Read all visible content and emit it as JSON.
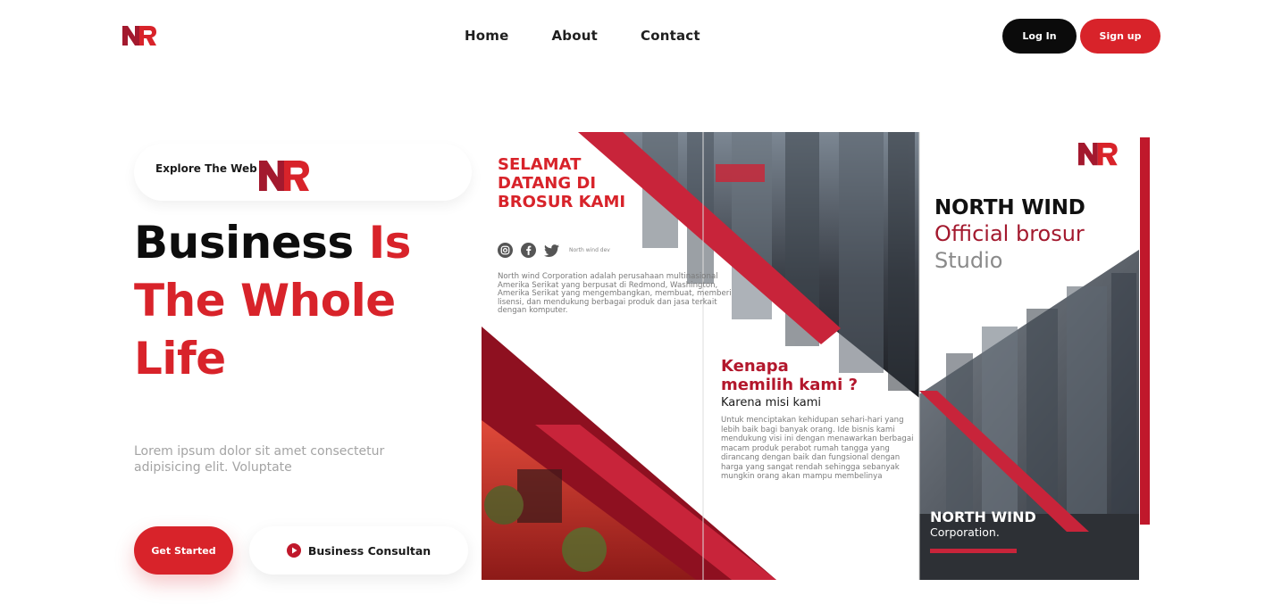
{
  "header": {
    "nav": [
      "Home",
      "About",
      "Contact"
    ],
    "login_label": "Log In",
    "signup_label": "Sign up"
  },
  "hero": {
    "explore_label": "Explore The Web",
    "headline_black": "Business",
    "headline_red_1": "Is",
    "headline_red_2": "The Whole",
    "headline_red_3": "Life",
    "description": "Lorem ipsum dolor sit amet consectetur adipisicing elit. Voluptate",
    "get_started_label": "Get Started",
    "consult_label": "Business Consultan"
  },
  "brochure": {
    "welcome_line1": "SELAMAT",
    "welcome_line2": "DATANG DI",
    "welcome_line3": "BROSUR KAMI",
    "social_handle": "North wind dev",
    "panel1_body": "North wind Corporation adalah perusahaan multinasional Amerika Serikat yang berpusat di Redmond, Washington, Amerika Serikat yang mengembangkan, membuat, memberi lisensi, dan mendukung berbagai produk dan jasa terkait dengan komputer.",
    "why_line1": "Kenapa",
    "why_line2": "memilih kami ?",
    "mission": "Karena misi kami",
    "panel2_body": "Untuk menciptakan kehidupan sehari-hari yang lebih baik bagi banyak orang. Ide bisnis kami mendukung visi ini dengan menawarkan berbagai macam produk perabot rumah tangga yang dirancang dengan baik dan fungsional dengan harga yang sangat rendah sehingga sebanyak mungkin orang akan mampu membelinya",
    "cover_title": "NORTH WIND",
    "cover_subtitle": "Official brosur",
    "cover_studio": "Studio",
    "footer_title": "NORTH WIND",
    "footer_sub": "Corporation."
  },
  "colors": {
    "brand_red": "#d8232a",
    "dark_red": "#8e1020",
    "dark_panel": "#2d3035"
  },
  "icons": [
    "nr-logo-icon",
    "instagram-icon",
    "facebook-icon",
    "twitter-icon",
    "play-icon"
  ]
}
